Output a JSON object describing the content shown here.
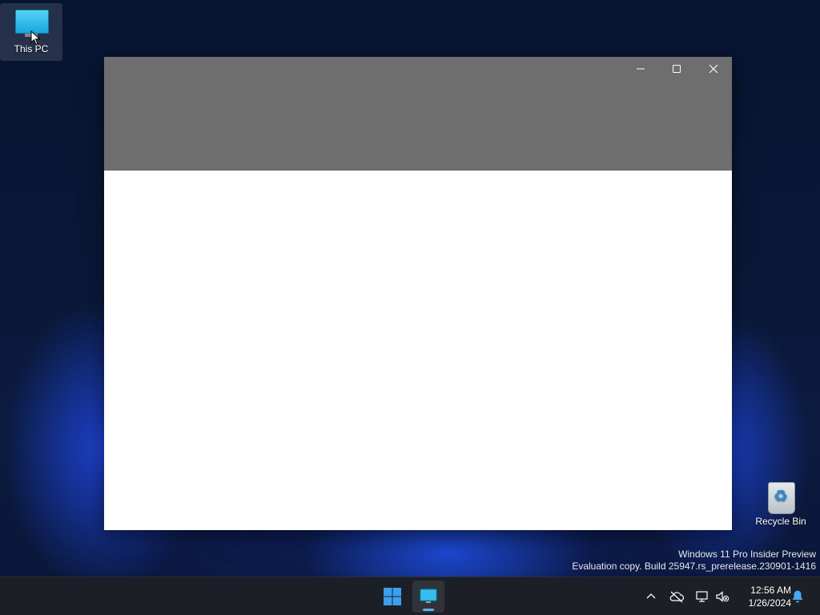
{
  "desktop": {
    "icons": [
      {
        "label": "This PC"
      },
      {
        "label": "Recycle Bin"
      }
    ]
  },
  "window": {
    "titlebar_color": "#6e6e6e",
    "body_color": "#ffffff",
    "controls": {
      "minimize": "minimize",
      "maximize": "maximize",
      "close": "close"
    }
  },
  "watermark": {
    "line1": "Windows 11 Pro Insider Preview",
    "line2": "Evaluation copy. Build 25947.rs_prerelease.230901-1416"
  },
  "taskbar": {
    "clock_time": "12:56 AM",
    "clock_date": "1/26/2024",
    "accent": "#5fb2f2",
    "tray_icons": [
      "chevron-up-icon",
      "cloud-offline-icon",
      "network-icon",
      "volume-muted-icon",
      "bell-icon"
    ]
  }
}
